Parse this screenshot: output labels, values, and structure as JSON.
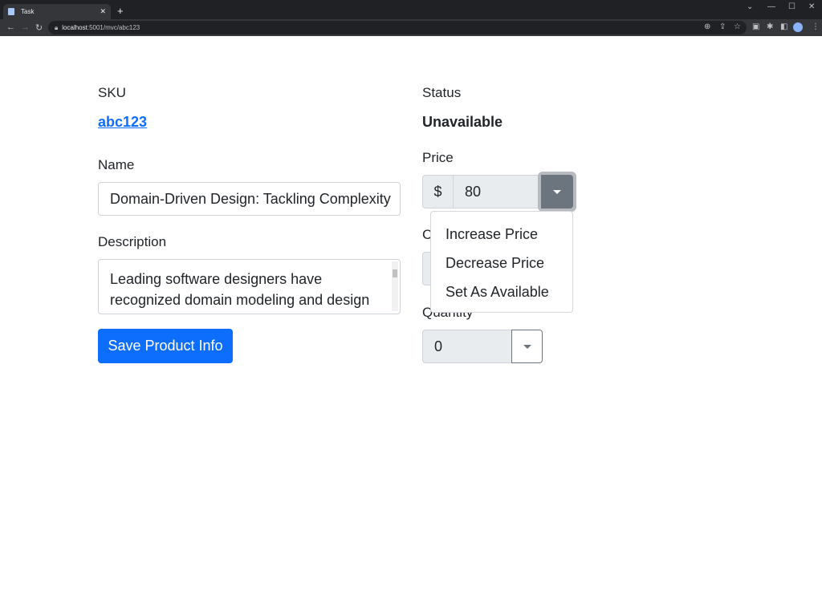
{
  "browser": {
    "tab_title": "Task",
    "url_host": "localhost",
    "url_path": ":5001/mvc/abc123"
  },
  "form": {
    "sku_label": "SKU",
    "sku_value": "abc123",
    "status_label": "Status",
    "status_value": "Unavailable",
    "name_label": "Name",
    "name_value": "Domain-Driven Design: Tackling Complexity",
    "description_label": "Description",
    "description_value": "Leading software designers have recognized domain modeling and design",
    "save_label": "Save Product Info",
    "price_label": "Price",
    "currency_symbol": "$",
    "price_value": "80",
    "hidden_label_partial": "C",
    "quantity_label": "Quantity",
    "quantity_value": "0"
  },
  "price_menu": {
    "items": [
      "Increase Price",
      "Decrease Price",
      "Set As Available"
    ]
  },
  "colors": {
    "primary": "#0d6efd",
    "secondary": "#6c757d"
  }
}
